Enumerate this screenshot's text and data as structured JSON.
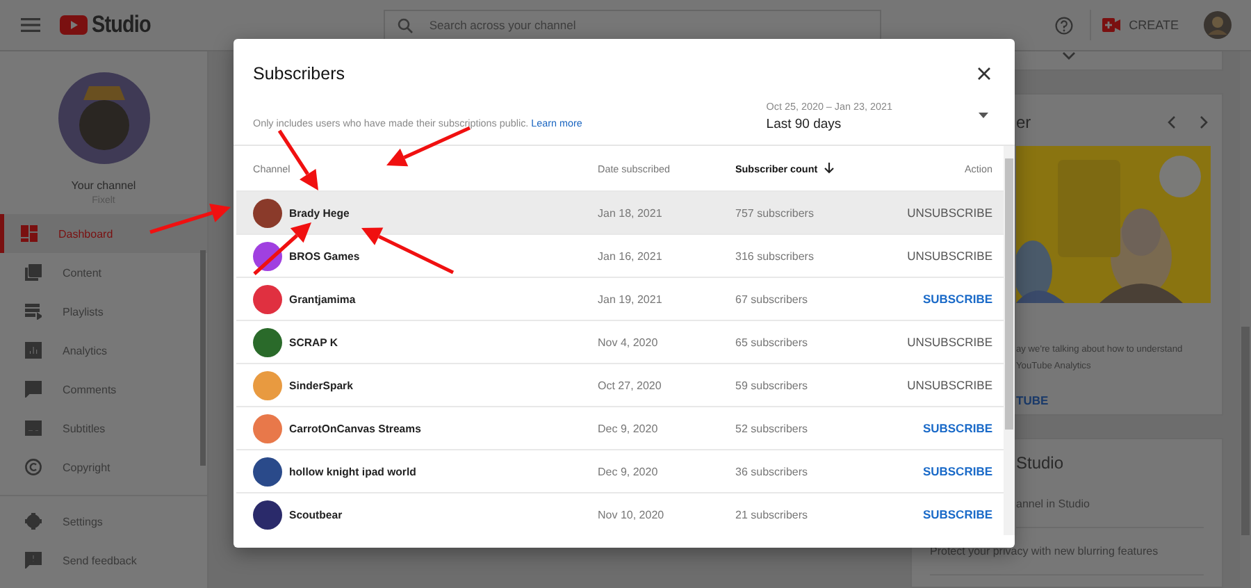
{
  "header": {
    "logo_text": "Studio",
    "search": {
      "placeholder": "Search across your channel"
    },
    "create_button": "CREATE"
  },
  "sidebar": {
    "channel_title": "Your channel",
    "channel_name": "Fixelt",
    "nav": [
      {
        "label": "Dashboard",
        "selected": true
      },
      {
        "label": "Content",
        "selected": false
      },
      {
        "label": "Playlists",
        "selected": false
      },
      {
        "label": "Analytics",
        "selected": false
      },
      {
        "label": "Comments",
        "selected": false
      },
      {
        "label": "Subtitles",
        "selected": false
      },
      {
        "label": "Copyright",
        "selected": false
      }
    ],
    "footer_nav": [
      {
        "label": "Settings",
        "selected": false
      },
      {
        "label": "Send feedback",
        "selected": false
      }
    ]
  },
  "news_card": {
    "title": "er",
    "lines": [
      "ay we're talking about how to understand",
      "YouTube Analytics"
    ],
    "link": "TUBE"
  },
  "whats_new_card": {
    "title": "Studio",
    "items": [
      "annel in Studio",
      "Protect your privacy with new blurring features"
    ]
  },
  "dialog": {
    "title": "Subscribers",
    "note": "Only includes users who have made their subscriptions public.",
    "note_link": "Learn more",
    "date_range": "Oct 25, 2020 – Jan 23, 2021",
    "period": "Last 90 days",
    "columns": [
      "Channel",
      "Date subscribed",
      "Subscriber count",
      "Action"
    ],
    "rows": [
      {
        "name": "Brady Hege",
        "date": "Jan 18, 2021",
        "count": "757 subscribers",
        "action": "UNSUBSCRIBE",
        "subscribed": true,
        "selected": true,
        "color": "#8a3a2a"
      },
      {
        "name": "BROS Games",
        "date": "Jan 16, 2021",
        "count": "316 subscribers",
        "action": "UNSUBSCRIBE",
        "subscribed": true,
        "selected": false,
        "color": "#a040e0"
      },
      {
        "name": "Grantjamima",
        "date": "Jan 19, 2021",
        "count": "67 subscribers",
        "action": "SUBSCRIBE",
        "subscribed": false,
        "selected": false,
        "color": "#e03040"
      },
      {
        "name": "SCRAP K",
        "date": "Nov 4, 2020",
        "count": "65 subscribers",
        "action": "UNSUBSCRIBE",
        "subscribed": true,
        "selected": false,
        "color": "#2a6a2a"
      },
      {
        "name": "SinderSpark",
        "date": "Oct 27, 2020",
        "count": "59 subscribers",
        "action": "UNSUBSCRIBE",
        "subscribed": true,
        "selected": false,
        "color": "#e89a40"
      },
      {
        "name": "CarrotOnCanvas Streams",
        "date": "Dec 9, 2020",
        "count": "52 subscribers",
        "action": "SUBSCRIBE",
        "subscribed": false,
        "selected": false,
        "color": "#e8784a"
      },
      {
        "name": "hollow knight ipad world",
        "date": "Dec 9, 2020",
        "count": "36 subscribers",
        "action": "SUBSCRIBE",
        "subscribed": false,
        "selected": false,
        "color": "#2a4a8a"
      },
      {
        "name": "Scoutbear",
        "date": "Nov 10, 2020",
        "count": "21 subscribers",
        "action": "SUBSCRIBE",
        "subscribed": false,
        "selected": false,
        "color": "#2a2a6a"
      }
    ]
  }
}
